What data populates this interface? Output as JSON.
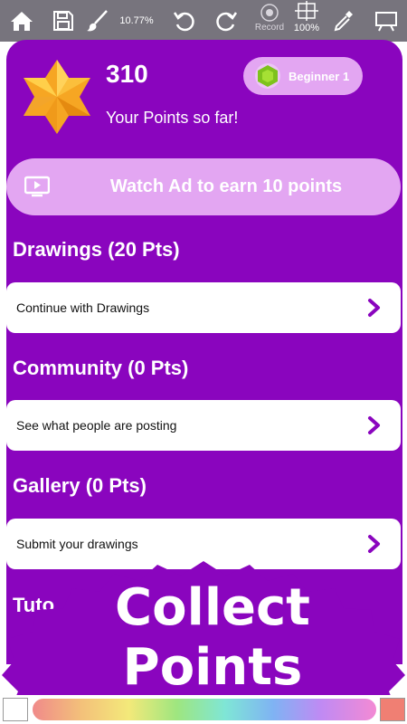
{
  "toolbar": {
    "home_icon": "home-icon",
    "save_icon": "save-icon",
    "brush_icon": "brush-icon",
    "zoom_percent_left": "10.77%",
    "undo_icon": "undo-icon",
    "redo_icon": "redo-icon",
    "record_label": "Record",
    "zoom_percent_right": "100%",
    "eyedropper_icon": "eyedropper-icon",
    "easel_icon": "easel-icon"
  },
  "header": {
    "points_value": "310",
    "points_caption": "Your Points so far!",
    "level_label": "Beginner 1"
  },
  "watch_ad": {
    "label": "Watch Ad to earn 10 points"
  },
  "sections": [
    {
      "title": "Drawings (20 Pts)",
      "card_label": "Continue with Drawings"
    },
    {
      "title": "Community (0 Pts)",
      "card_label": "See what people are posting"
    },
    {
      "title": "Gallery (0 Pts)",
      "card_label": "Submit your drawings"
    }
  ],
  "partial_section_title": "Tuto",
  "overlay": {
    "line1": "Collect",
    "line2": "Points"
  },
  "colors": {
    "purple": "#8a05be",
    "lavender": "#e3a6f2",
    "toolbar": "#77747d",
    "selected_swatch": "#f07f73"
  }
}
